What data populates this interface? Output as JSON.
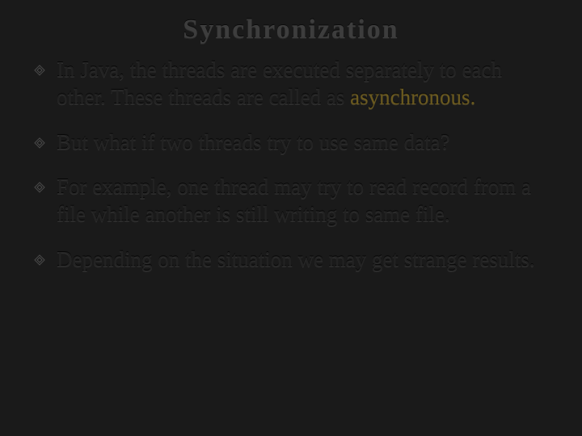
{
  "title": "Synchronization",
  "bullets": [
    {
      "pre": "In Java, the threads are executed separately to each other. These threads are called as ",
      "emph": "asynchronous.",
      "post": ""
    },
    {
      "pre": "But what if two threads try to use same data?",
      "emph": "",
      "post": ""
    },
    {
      "pre": "For example, one thread may try to read record from a file while another is still writing to same file.",
      "emph": "",
      "post": ""
    },
    {
      "pre": "Depending on the situation we may get strange results.",
      "emph": "",
      "post": ""
    }
  ]
}
